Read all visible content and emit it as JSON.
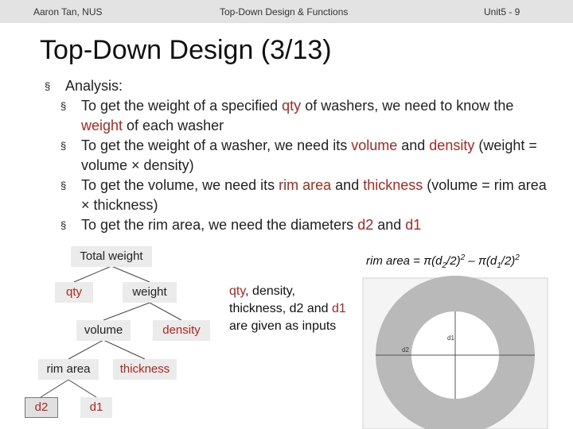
{
  "header": {
    "left": "Aaron Tan, NUS",
    "center": "Top-Down Design & Functions",
    "right": "Unit5 - 9"
  },
  "title": "Top-Down Design (3/13)",
  "bullets": {
    "marker": "§",
    "analysis": "Analysis:",
    "items": [
      {
        "p1": "To get the weight of a specified ",
        "h1": "qty",
        "p2": " of washers, we need to know the ",
        "h2": "weight",
        "p3": " of each washer"
      },
      {
        "p1": "To get the weight of a washer, we need its ",
        "h1": "volume",
        "p2": " and ",
        "h2": "density",
        "p3": " (weight = volume × density)"
      },
      {
        "p1": "To get the volume, we need its ",
        "h1": "rim area",
        "p2": " and ",
        "h2": "thickness",
        "p3": " (volume = rim area × thickness)"
      },
      {
        "p1": "To get the rim area, we need the diameters ",
        "h1": "d2",
        "p2": " and ",
        "h2": "d1",
        "p3": ""
      }
    ]
  },
  "tree": {
    "total_weight": "Total weight",
    "qty": "qty",
    "weight": "weight",
    "volume": "volume",
    "density": "density",
    "rim_area": "rim area",
    "thickness": "thickness",
    "d2": "d2",
    "d1": "d1"
  },
  "inputs_note": {
    "t1": "qty",
    "t2": ", density, thickness, d2 and ",
    "t3": "d1",
    "t4": " are given as inputs"
  },
  "formula": {
    "lhs": "rim area = π(d",
    "s1": "2",
    "mid": "/2)",
    "sq1": "2",
    "minus": " – π(d",
    "s2": "1",
    "end": "/2)",
    "sq2": "2"
  },
  "figure": {
    "label_d2": "d2",
    "label_d1": "d1"
  },
  "colors": {
    "highlight": "#b0271e",
    "node_fill": "#ebebeb"
  }
}
